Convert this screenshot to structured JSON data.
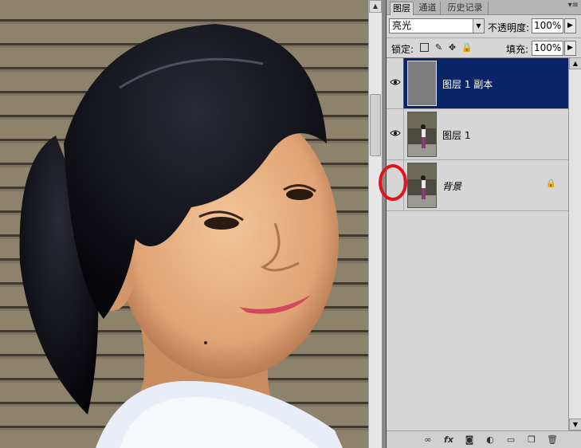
{
  "panel": {
    "tabs": [
      {
        "label": "图层",
        "active": true
      },
      {
        "label": "通道",
        "active": false
      },
      {
        "label": "历史记录",
        "active": false
      }
    ],
    "blend_mode": "亮光",
    "opacity_label": "不透明度:",
    "opacity_value": "100%",
    "lock_label": "锁定:",
    "fill_label": "填充:",
    "fill_value": "100%",
    "layers": [
      {
        "name": "图层 1 副本",
        "visible": true,
        "selected": true,
        "thumb": "gray"
      },
      {
        "name": "图层 1",
        "visible": true,
        "selected": false,
        "thumb": "photo"
      },
      {
        "name": "背景",
        "visible": false,
        "selected": false,
        "thumb": "photo",
        "locked": true
      }
    ],
    "bottom_icons": [
      "link-icon",
      "fx-icon",
      "mask-icon",
      "adjustment-icon",
      "group-icon",
      "new-layer-icon",
      "trash-icon"
    ]
  },
  "highlight_color": "#e0141b",
  "selection_color": "#0a2468"
}
